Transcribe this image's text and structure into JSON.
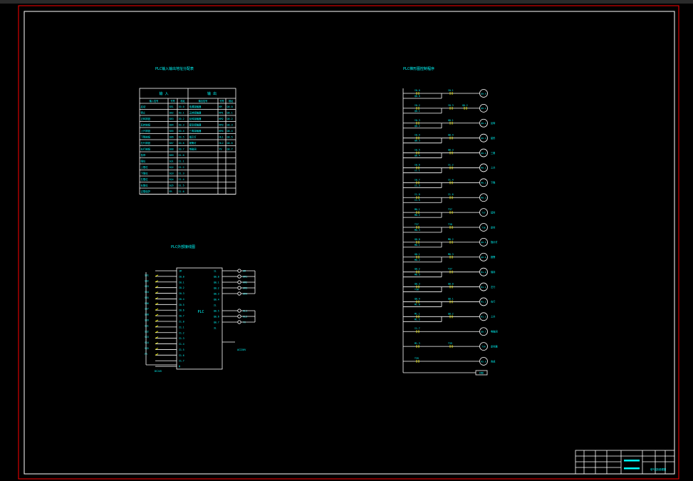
{
  "colors": {
    "background": "#000000",
    "border": "#ff0000",
    "frame": "#ffffff",
    "wire": "#ffffff",
    "component": "#00ffff",
    "accent": "#ffff00"
  },
  "title_block": {
    "drawing_name": "电气控制原理图"
  },
  "io_table": {
    "title": "PLC输入输出地址分配表",
    "header_input": "输    入",
    "header_output": "输    出",
    "subheaders": [
      "输入信号",
      "代号",
      "地址",
      "输出信号",
      "代号",
      "地址"
    ],
    "rows": [
      [
        "启动",
        "SB1",
        "I0.0",
        "电源接触器",
        "KM",
        "Q0.0"
      ],
      [
        "停止",
        "SB2",
        "I0.1",
        "正转接触器",
        "KM1",
        "Q0.1"
      ],
      [
        "正转按钮",
        "SB3",
        "I0.2",
        "反转接触器",
        "KM2",
        "Q0.2"
      ],
      [
        "反转按钮",
        "SB4",
        "I0.3",
        "星形接触器",
        "KM3",
        "Q0.3"
      ],
      [
        "上升按钮",
        "SB5",
        "I0.4",
        "三角接触器",
        "KM4",
        "Q0.4"
      ],
      [
        "下降按钮",
        "SB6",
        "I0.5",
        "指示灯",
        "HL1",
        "Q0.5"
      ],
      [
        "左行按钮",
        "SB7",
        "I0.6",
        "报警灯",
        "HL2",
        "Q0.6"
      ],
      [
        "右行按钮",
        "SB8",
        "I0.7",
        "电磁阀",
        "YV",
        "Q0.7"
      ],
      [
        "急停",
        "SB9",
        "I1.0",
        "",
        "",
        ""
      ],
      [
        "限位",
        "SQ1",
        "I1.1",
        "",
        "",
        ""
      ],
      [
        "上限位",
        "SQ2",
        "I1.2",
        "",
        "",
        ""
      ],
      [
        "下限位",
        "SQ3",
        "I1.3",
        "",
        "",
        ""
      ],
      [
        "左限位",
        "SQ4",
        "I1.4",
        "",
        "",
        ""
      ],
      [
        "右限位",
        "SQ5",
        "I1.5",
        "",
        "",
        ""
      ],
      [
        "过载保护",
        "FR",
        "I1.6",
        "",
        "",
        ""
      ]
    ]
  },
  "plc_wiring": {
    "title": "PLC外部接线图",
    "plc_label": "PLC",
    "power_left": "DC24V",
    "power_right": "AC220V",
    "inputs": [
      "SB1",
      "SB2",
      "SB3",
      "SB4",
      "SB5",
      "SB6",
      "SB7",
      "SB8",
      "SB9",
      "SQ1",
      "SQ2",
      "SQ3",
      "SQ4",
      "SQ5",
      "FR"
    ],
    "input_pins": [
      "1M",
      "I0.0",
      "I0.1",
      "I0.2",
      "I0.3",
      "I0.4",
      "I0.5",
      "I0.6",
      "I0.7",
      "I1.0",
      "I1.1",
      "I1.2",
      "I1.3",
      "I1.4",
      "I1.5",
      "I1.6",
      "I1.7",
      "M"
    ],
    "output_pins": [
      "1L",
      "Q0.0",
      "Q0.1",
      "Q0.2",
      "Q0.3",
      "Q0.4",
      "2L",
      "Q0.5",
      "Q0.6",
      "Q0.7",
      "3L"
    ],
    "outputs": [
      "KM",
      "KM1",
      "KM2",
      "KM3",
      "KM4",
      "HL1",
      "HL2",
      "YV"
    ]
  },
  "ladder": {
    "title": "PLC梯形图控制程序",
    "end_label": "END",
    "rungs": [
      {
        "contacts": [
          "I0.0",
          "Q0.0"
        ],
        "series": [
          "I0.1"
        ],
        "coil": "Q0.0",
        "note": ""
      },
      {
        "contacts": [
          "I0.2",
          "Q0.1"
        ],
        "series": [
          "I0.3",
          "Q0.2"
        ],
        "coil": "Q0.1",
        "note": ""
      },
      {
        "contacts": [
          "I0.3",
          "Q0.2"
        ],
        "series": [
          "Q0.1"
        ],
        "coil": "Q0.2",
        "note": "反转"
      },
      {
        "contacts": [
          "I0.4",
          "Q0.3"
        ],
        "series": [
          "Q0.4"
        ],
        "coil": "Q0.3",
        "note": "星形"
      },
      {
        "contacts": [
          "I0.5",
          "Q0.4"
        ],
        "series": [
          "Q0.3"
        ],
        "coil": "Q0.4",
        "note": "三角"
      },
      {
        "contacts": [
          "I0.6",
          "I1.1"
        ],
        "series": [
          "I1.2"
        ],
        "coil": "M0.1",
        "note": "上升"
      },
      {
        "contacts": [
          "I0.7",
          "I1.3"
        ],
        "series": [
          "I1.4"
        ],
        "coil": "M0.2",
        "note": "下降"
      },
      {
        "contacts": [
          "I1.0",
          "I1.5"
        ],
        "series": [
          "I1.6"
        ],
        "coil": "M0.3",
        "note": ""
      },
      {
        "contacts": [
          "M0.1",
          "M0.2"
        ],
        "series": [
          "T37"
        ],
        "coil": "T37",
        "note": "延时"
      },
      {
        "contacts": [
          "T37",
          "M0.3"
        ],
        "series": [
          "T38"
        ],
        "coil": "T38",
        "note": "定时"
      },
      {
        "contacts": [
          "Q0.0",
          "M0.1"
        ],
        "series": [
          "M0.2"
        ],
        "coil": "Q0.5",
        "note": "指示灯"
      },
      {
        "contacts": [
          "Q0.1",
          "M0.2"
        ],
        "series": [
          "M0.3"
        ],
        "coil": "Q0.6",
        "note": "报警"
      },
      {
        "contacts": [
          "Q0.2",
          "M0.3"
        ],
        "series": [
          "T37"
        ],
        "coil": "M1.0",
        "note": "保持"
      },
      {
        "contacts": [
          "Q0.3",
          "T38"
        ],
        "series": [
          "Q0.0"
        ],
        "coil": "M1.1",
        "note": "左行"
      },
      {
        "contacts": [
          "Q0.4",
          "M1.0"
        ],
        "series": [
          "Q0.1"
        ],
        "coil": "M1.2",
        "note": "右行"
      },
      {
        "contacts": [
          "M1.1",
          "M1.2"
        ],
        "series": [
          "Q0.2"
        ],
        "coil": "M1.3",
        "note": "上升"
      },
      {
        "contacts": [
          "I1.7"
        ],
        "series": [],
        "coil": "Q0.7",
        "note": "电磁阀"
      },
      {
        "contacts": [
          "M1.3"
        ],
        "series": [
          "T39"
        ],
        "coil": "T39",
        "note": "定时器"
      },
      {
        "contacts": [
          "T39"
        ],
        "series": [],
        "coil": "M2.0",
        "note": "完成"
      }
    ]
  }
}
